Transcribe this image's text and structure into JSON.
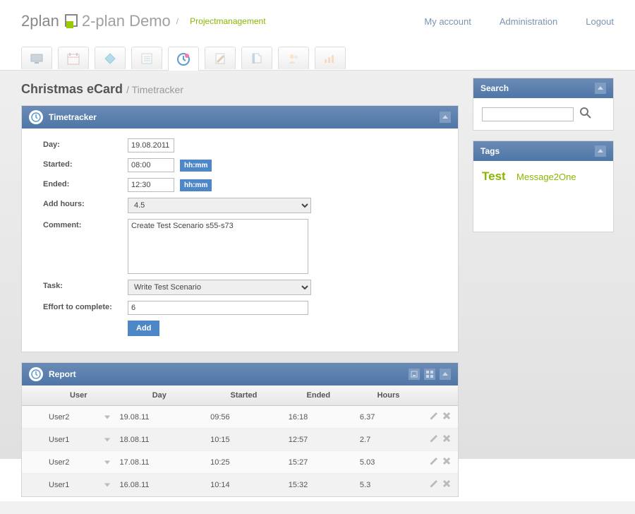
{
  "header": {
    "brand": "2-plan Demo",
    "crumb": "Projectmanagement",
    "nav": {
      "account": "My account",
      "admin": "Administration",
      "logout": "Logout"
    }
  },
  "page": {
    "title": "Christmas eCard",
    "subtitle": "Timetracker"
  },
  "timetracker": {
    "heading": "Timetracker",
    "labels": {
      "day": "Day:",
      "started": "Started:",
      "ended": "Ended:",
      "add_hours": "Add hours:",
      "comment": "Comment:",
      "task": "Task:",
      "effort": "Effort to complete:"
    },
    "values": {
      "day": "19.08.2011",
      "started": "08:00",
      "ended": "12:30",
      "add_hours": "4.5",
      "comment": "Create Test Scenario s55-s73",
      "task": "Write Test Scenario",
      "effort": "6"
    },
    "hint": "hh:mm",
    "add_btn": "Add"
  },
  "report": {
    "heading": "Report",
    "columns": {
      "user": "User",
      "day": "Day",
      "started": "Started",
      "ended": "Ended",
      "hours": "Hours"
    },
    "rows": [
      {
        "user": "User2",
        "day": "19.08.11",
        "started": "09:56",
        "ended": "16:18",
        "hours": "6.37"
      },
      {
        "user": "User1",
        "day": "18.08.11",
        "started": "10:15",
        "ended": "12:57",
        "hours": "2.7"
      },
      {
        "user": "User2",
        "day": "17.08.11",
        "started": "10:25",
        "ended": "15:27",
        "hours": "5.03"
      },
      {
        "user": "User1",
        "day": "16.08.11",
        "started": "10:14",
        "ended": "15:32",
        "hours": "5.3"
      }
    ]
  },
  "sidebar": {
    "search": {
      "heading": "Search"
    },
    "tags": {
      "heading": "Tags",
      "items": [
        "Test",
        "Message2One"
      ]
    }
  }
}
